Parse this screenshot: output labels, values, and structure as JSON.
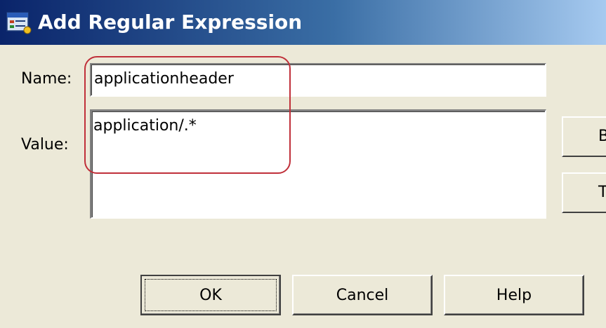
{
  "window": {
    "title": "Add Regular Expression",
    "icon": "regex-dialog-icon"
  },
  "form": {
    "name_label": "Name:",
    "name_value": "applicationheader",
    "value_label": "Value:",
    "value_value": "application/.*"
  },
  "side_buttons": {
    "first_label": "B",
    "second_label": "T"
  },
  "buttons": {
    "ok": "OK",
    "cancel": "Cancel",
    "help": "Help"
  },
  "colors": {
    "titlebar_start": "#0a246a",
    "titlebar_end": "#a6caf0",
    "highlight": "#c0303a",
    "dialog_bg": "#ece9d8"
  }
}
